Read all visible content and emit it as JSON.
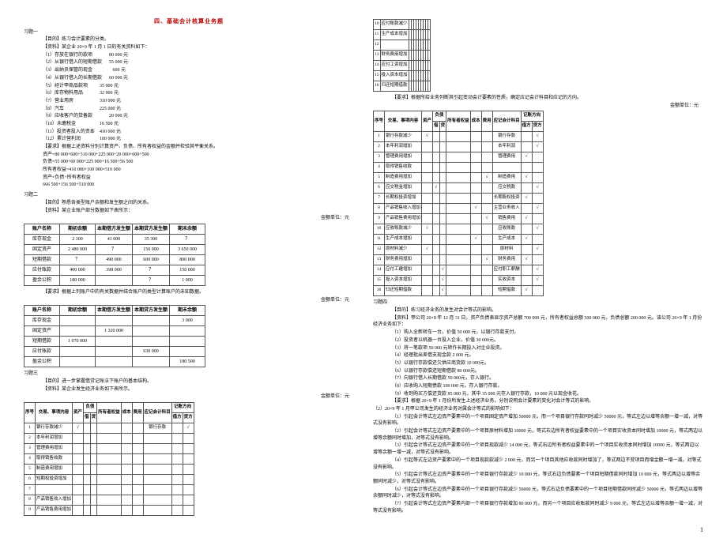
{
  "title_main": "四、基础会计核算业务题",
  "x1_h": "习题一",
  "x1_obj": "【目的】练习会计要素的分类。",
  "x1_src": "【资料】某企业 20×9 年 1 月 1 日的有关资料如下：",
  "x1_items": [
    "（1）存放在银行的款项\t\t80 000 元",
    "（2）从银行借入的短期借款\t55 000 元",
    "（3）出纳员保管的现金\t\t   600 元",
    "（4）从银行借入的长期借款\t60 000 元",
    "（5）经计甲商品款项\t\t35 000 元",
    "（6）库存物料用品\t\t32 900 元",
    "（7）营业用房\t\t\t310 000 元",
    "（8）汽车\t\t\t\t225 000 元",
    "（9）应收客户的货备款\t\t20 000 元",
    "（10）未缴税金\t\t\t16 500 元",
    "（11）投资者投入的资本\t410 000 元",
    "（12）累计营利润\t\t100 000 元"
  ],
  "x1_req": "【要求】根据上述资料分别计算资产、负债、所有者权益的金额并检验其平衡关系。",
  "x1_ans": [
    "资产=80 000+600+310 000+225 000+20 000+000+500",
    "负债=55 000+60 000+225 000+16 500+56 500",
    "所有者权益=410 000+100 000=510 000",
    "资产=负债+所有者权益",
    "666 500+156 500+510 000"
  ],
  "x2_h": "习题二",
  "x2_obj": "【目的】熟悉各类型账户余额和发生额之间的关系。",
  "x2_src": "【资料】某企业账户部分数据如下表所示：",
  "unit": "金额单位：元",
  "t2_head": [
    "账户名称",
    "期初余额",
    "本期借方发生额",
    "本期贷方发生额",
    "期末余额"
  ],
  "t2_rows": [
    [
      "库存现金",
      "2 300",
      "41 000",
      "35 300",
      "？"
    ],
    [
      "固定资产",
      "2 480 000",
      "？",
      "150 000",
      "3 650 000"
    ],
    [
      "短期借款",
      "？",
      "490 000",
      "600 000",
      "800 000"
    ],
    [
      "应付账款",
      "400 000",
      "398 000",
      "？",
      "150 000"
    ],
    [
      "盈余公积",
      "180 000",
      "",
      "？",
      "1 000"
    ]
  ],
  "x2_req": "【要求】根据上列账户中的有关数据并结合账户的类型计算账户的未知数据。",
  "t2b_rows": [
    [
      "库存现金",
      "",
      "",
      "",
      "3 000"
    ],
    [
      "固定资产",
      "",
      "1 320 000",
      "",
      ""
    ],
    [
      "短期借款",
      "1 070 000",
      "",
      "",
      ""
    ],
    [
      "应付账款",
      "",
      "",
      "630 000",
      ""
    ],
    [
      "盈余公积",
      "",
      "",
      "",
      "180 500"
    ]
  ],
  "x3_h": "习题三",
  "x3_obj": "【目的】进一步掌握借贷记账法下账户的基本结构。",
  "x3_src": "【资料】某企业发生经济业务如下表所示。",
  "t3_head_top": [
    "序号",
    "交易、事项内容",
    "资产",
    "负债",
    "所有者权益",
    "成本",
    "费用",
    "应记会计科目",
    "记账方向"
  ],
  "t3_head_sub": [
    "借",
    "贷",
    "借方",
    "贷方"
  ],
  "t3_left_rows": [
    [
      "1",
      "银行存款减少",
      "√",
      "",
      "",
      "",
      "",
      "",
      "银行存款",
      "",
      "√"
    ],
    [
      "2",
      "本年利润增加",
      "",
      "",
      "",
      "",
      "",
      "",
      "",
      "",
      ""
    ],
    [
      "3",
      "管理费用增加",
      "",
      "",
      "",
      "",
      "",
      "",
      "",
      "",
      ""
    ],
    [
      "4",
      "取得销售收款",
      "",
      "",
      "",
      "",
      "",
      "",
      "",
      "",
      ""
    ],
    [
      "5",
      "制造费用增加",
      "",
      "",
      "",
      "",
      "",
      "",
      "",
      "",
      ""
    ],
    [
      "6",
      "短期权投资增加",
      "",
      "",
      "",
      "",
      "",
      "",
      "",
      "",
      ""
    ],
    [
      "7",
      "",
      "",
      "",
      "",
      "",
      "",
      "",
      "",
      "",
      ""
    ],
    [
      "8",
      "产品销售收入增加",
      "",
      "",
      "",
      "",
      "",
      "",
      "",
      "",
      ""
    ],
    [
      "9",
      "产品销售费用增加",
      "",
      "",
      "",
      "",
      "",
      "",
      "",
      "",
      ""
    ]
  ],
  "t3_right_top": [
    [
      "10",
      "应付账款减少",
      "",
      "",
      "",
      "",
      "",
      "",
      "",
      "",
      ""
    ],
    [
      "11",
      "生产成本增加",
      "",
      "",
      "",
      "",
      "",
      "",
      "",
      "",
      ""
    ],
    [
      "12",
      "",
      "",
      "",
      "",
      "",
      "",
      "",
      "",
      "",
      ""
    ],
    [
      "13",
      "财务费用增加",
      "",
      "",
      "",
      "",
      "",
      "",
      "",
      "",
      ""
    ],
    [
      "14",
      "应付工资增加",
      "",
      "",
      "",
      "",
      "",
      "",
      "",
      "",
      ""
    ],
    [
      "15",
      "投入资本增加",
      "",
      "",
      "",
      "",
      "",
      "",
      "",
      "",
      ""
    ],
    [
      "16",
      "归还短期借款",
      "",
      "",
      "",
      "",
      "",
      "",
      "",
      "",
      ""
    ]
  ],
  "x3_req": "【要求】根据所给业务列断其引起变动会计要素的性质，确定应记会计科目和应记的方向。",
  "t3b_head_top": [
    "序号",
    "交易、事项内容",
    "资产",
    "负债",
    "所有者权益",
    "成本",
    "费用",
    "应记会计科目",
    "记账方向"
  ],
  "t3b_rows": [
    [
      "1",
      "银行存款减少",
      "√",
      "",
      "",
      "",
      "",
      "",
      "银行存款",
      "",
      "√"
    ],
    [
      "2",
      "本年利润增加",
      "",
      "",
      "",
      "",
      "",
      "",
      "本年利润",
      "",
      "√"
    ],
    [
      "3",
      "管理费用增加",
      "",
      "",
      "",
      "",
      "",
      "",
      "管理费用",
      "√",
      ""
    ],
    [
      "4",
      "取得销售收款",
      "",
      "",
      "",
      "",
      "",
      "",
      "",
      "",
      ""
    ],
    [
      "5",
      "制造费用增加",
      "",
      "",
      "",
      "",
      "",
      "√",
      "制造费用",
      "√",
      ""
    ],
    [
      "6",
      "应交税金增加",
      "",
      "√",
      "",
      "",
      "",
      "",
      "应交税款",
      "",
      "√"
    ],
    [
      "7",
      "长期权投资增加",
      "",
      "",
      "",
      "",
      "",
      "",
      "长期股权投资",
      "√",
      ""
    ],
    [
      "8",
      "产品销售收入增加",
      "",
      "",
      "",
      "",
      "√",
      "",
      "主营业务收入",
      "",
      "√"
    ],
    [
      "9",
      "产品销售费用增加",
      "",
      "",
      "",
      "",
      "",
      "√",
      "销售费用",
      "√",
      ""
    ],
    [
      "10",
      "应收账款减少",
      "√",
      "",
      "",
      "",
      "",
      "",
      "应收账款",
      "",
      "√"
    ],
    [
      "11",
      "生产成本增加",
      "",
      "",
      "",
      "",
      "√",
      "",
      "生产成本",
      "√",
      ""
    ],
    [
      "12",
      "原材料减少",
      "√",
      "",
      "",
      "",
      "",
      "",
      "原材料",
      "",
      "√"
    ],
    [
      "13",
      "财务费用增加",
      "",
      "",
      "",
      "",
      "",
      "√",
      "财务费用",
      "√",
      ""
    ],
    [
      "14",
      "应付工建增加",
      "",
      "",
      "√",
      "",
      "",
      "",
      "应付职工薪酬",
      "",
      "√"
    ],
    [
      "15",
      "投入资本增加",
      "",
      "",
      "√",
      "",
      "",
      "",
      "实收资本",
      "",
      "√"
    ],
    [
      "16",
      "归还短期借款",
      "",
      "",
      "√",
      "",
      "",
      "",
      "短期借款",
      "√",
      ""
    ]
  ],
  "x4_h": "习题四",
  "x4_obj": "【目的】练习经济业务的发生对会计等式的影响。",
  "x4_src": "【资料】甲公司 20×8 年 12 月 31 日，资产负债表显示资产总额 700 000 元，所有者权益总额 500 000 元，负债总额 200 000 元。该公司 20×9 年 1 月份经济业务如下：",
  "x4_biz": [
    "（1）购入全新轿车一台，价值 50 000 元，以银行存款支付。",
    "（2）投资者以机器一台投入企业，价值 30 000元。",
    "（3）将一笔款项 50 000 元转作长期投入对企业投资。",
    "（4）经理批出差借支现金款 2 000 元。",
    "（5）以银行存款偿还欠供应商货款 10 000元。",
    "（6）以银行存款偿还短期借款 80 000元。",
    "（7）向银行借入长期借款 50 000元，存入银行。",
    "（8）应收购入短期债款 100 000 元，存入银行存款。",
    "（9）收到购买方偿还货款 85 000 元，其中 35 000 元存入银行存款，10 000 元以现金收花。",
    "【要求】根据 20×9 年 1 月份所发生上述经济业务，分别说明会计要素的变化对会计等式的影响。"
  ],
  "x4_ans_h": "（2）20×9 年 1 月甲公司发生的经济业务对属会计等式的影响如下：",
  "x4_ans": [
    "（1）引起会计等式左边资产要素中的一个项目固定资产增加 50000 元，而一个项目银行存款同时减少 50000 元，等式左边以增等余额一增一减，对等式没有影响。",
    "（2）引起会计等式左边资产要素中的一个项目原材料增加 10000 元，等式右边所有者权益要素中的一个项目实收资本同时增加 10000 元，等式两边以增等余额同时增加，对等式没有影响。",
    "（3）引起会计等式左边资产要素中的一个项目现款减少 14 000 元，等式右边所有者权益要素中的一个项目实收资本同时增加 10000 元，等式两边以增等余额一增一减，对等式没有影响。",
    "（4）引起等式左边资产要素中的一个项目现款款减少 2 000 元，而另一个项目其他应收款同时增加了，等式两边不变项目而增金额一增一减，对等式没有影响。",
    "（5）引起会计等式左边资产要素中的一个项目银行存款减少 10 000 元，等式右边负债要素一个项目短期借款同时增加 10 000 元，等式两边以增等余额同时减少，对等式没有影响。",
    "（6）引起会计等式左边资产要素中的一个项目银行存款减少 50000 元，等式右边负债要素中的一个项目短期借款同时减少 50000 元，等式两边以增等余额同时减少，对等式没有影响。",
    "（7）引起会计等式左边资产要素内部一个项目银行存款增加 80 000 元，而另一个项目应收账款同时减少 9 000 元，等式左边以增等余额一增一减，对等式没有影响。"
  ],
  "pageno": "1"
}
